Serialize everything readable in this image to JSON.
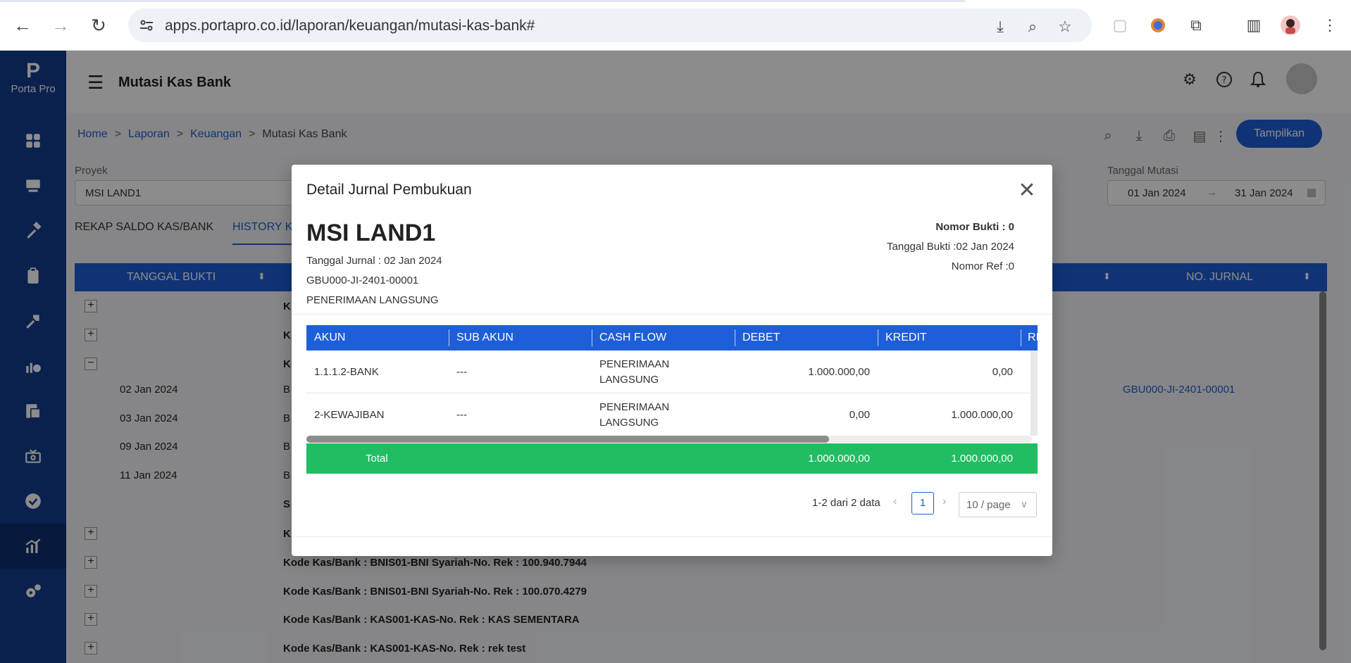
{
  "browser": {
    "url": "apps.portapro.co.id/laporan/keuangan/mutasi-kas-bank#"
  },
  "app": {
    "logo_text": "Porta Pro",
    "page_title": "Mutasi Kas Bank",
    "breadcrumb": [
      "Home",
      "Laporan",
      "Keuangan",
      "Mutasi Kas Bank"
    ],
    "breadcrumb_sep": ">",
    "tampilkan_label": "Tampilkan",
    "proyek_label": "Proyek",
    "proyek_value": "MSI LAND1",
    "tanggal_mutasi_label": "Tanggal Mutasi",
    "date_from": "01 Jan 2024",
    "date_arrow": "→",
    "date_to": "31 Jan 2024",
    "tabs": [
      "REKAP SALDO KAS/BANK",
      "HISTORY KA"
    ],
    "table_headers": [
      "TANGGAL BUKTI",
      "NO. JURNAL"
    ],
    "rows": [
      {
        "expand": "+",
        "date": "",
        "text": "K"
      },
      {
        "expand": "+",
        "date": "",
        "text": "K"
      },
      {
        "expand": "−",
        "date": "",
        "text": "K"
      },
      {
        "expand": "",
        "date": "02 Jan 2024",
        "text": "B",
        "jurnal": "GBU000-JI-2401-00001"
      },
      {
        "expand": "",
        "date": "03 Jan 2024",
        "text": "B"
      },
      {
        "expand": "",
        "date": "09 Jan 2024",
        "text": "B"
      },
      {
        "expand": "",
        "date": "11 Jan 2024",
        "text": "B"
      },
      {
        "expand": "",
        "date": "",
        "text": "S"
      },
      {
        "expand": "+",
        "date": "",
        "text": "K"
      },
      {
        "expand": "+",
        "date": "",
        "text": "Kode Kas/Bank : BNIS01-BNI Syariah-No. Rek : 100.940.7944"
      },
      {
        "expand": "+",
        "date": "",
        "text": "Kode Kas/Bank : BNIS01-BNI Syariah-No. Rek : 100.070.4279"
      },
      {
        "expand": "+",
        "date": "",
        "text": "Kode Kas/Bank : KAS001-KAS-No. Rek : KAS SEMENTARA"
      },
      {
        "expand": "+",
        "date": "",
        "text": "Kode Kas/Bank : KAS001-KAS-No. Rek : rek test"
      }
    ]
  },
  "modal": {
    "title": "Detail Jurnal Pembukuan",
    "close": "✕",
    "project_name": "MSI LAND1",
    "tanggal_jurnal": "Tanggal Jurnal : 02 Jan 2024",
    "kode_jurnal": "GBU000-JI-2401-00001",
    "jenis": "PENERIMAAN LANGSUNG",
    "nomor_bukti": "Nomor Bukti : 0",
    "tanggal_bukti": "Tanggal Bukti :02 Jan 2024",
    "nomor_ref": "Nomor Ref :0",
    "headers": [
      "AKUN",
      "SUB AKUN",
      "CASH FLOW",
      "DEBET",
      "KREDIT",
      "RI"
    ],
    "lines": [
      {
        "akun": "1.1.1.2-BANK",
        "sub_akun": "---",
        "cash_flow_1": "PENERIMAAN",
        "cash_flow_2": "LANGSUNG",
        "debet": "1.000.000,00",
        "kredit": "0,00"
      },
      {
        "akun": "2-KEWAJIBAN",
        "sub_akun": "---",
        "cash_flow_1": "PENERIMAAN",
        "cash_flow_2": "LANGSUNG",
        "debet": "0,00",
        "kredit": "1.000.000,00"
      }
    ],
    "total_label": "Total",
    "total_debet": "1.000.000,00",
    "total_kredit": "1.000.000,00",
    "pagination_info": "1-2 dari 2 data",
    "page": "1",
    "page_size": "10 / page"
  }
}
